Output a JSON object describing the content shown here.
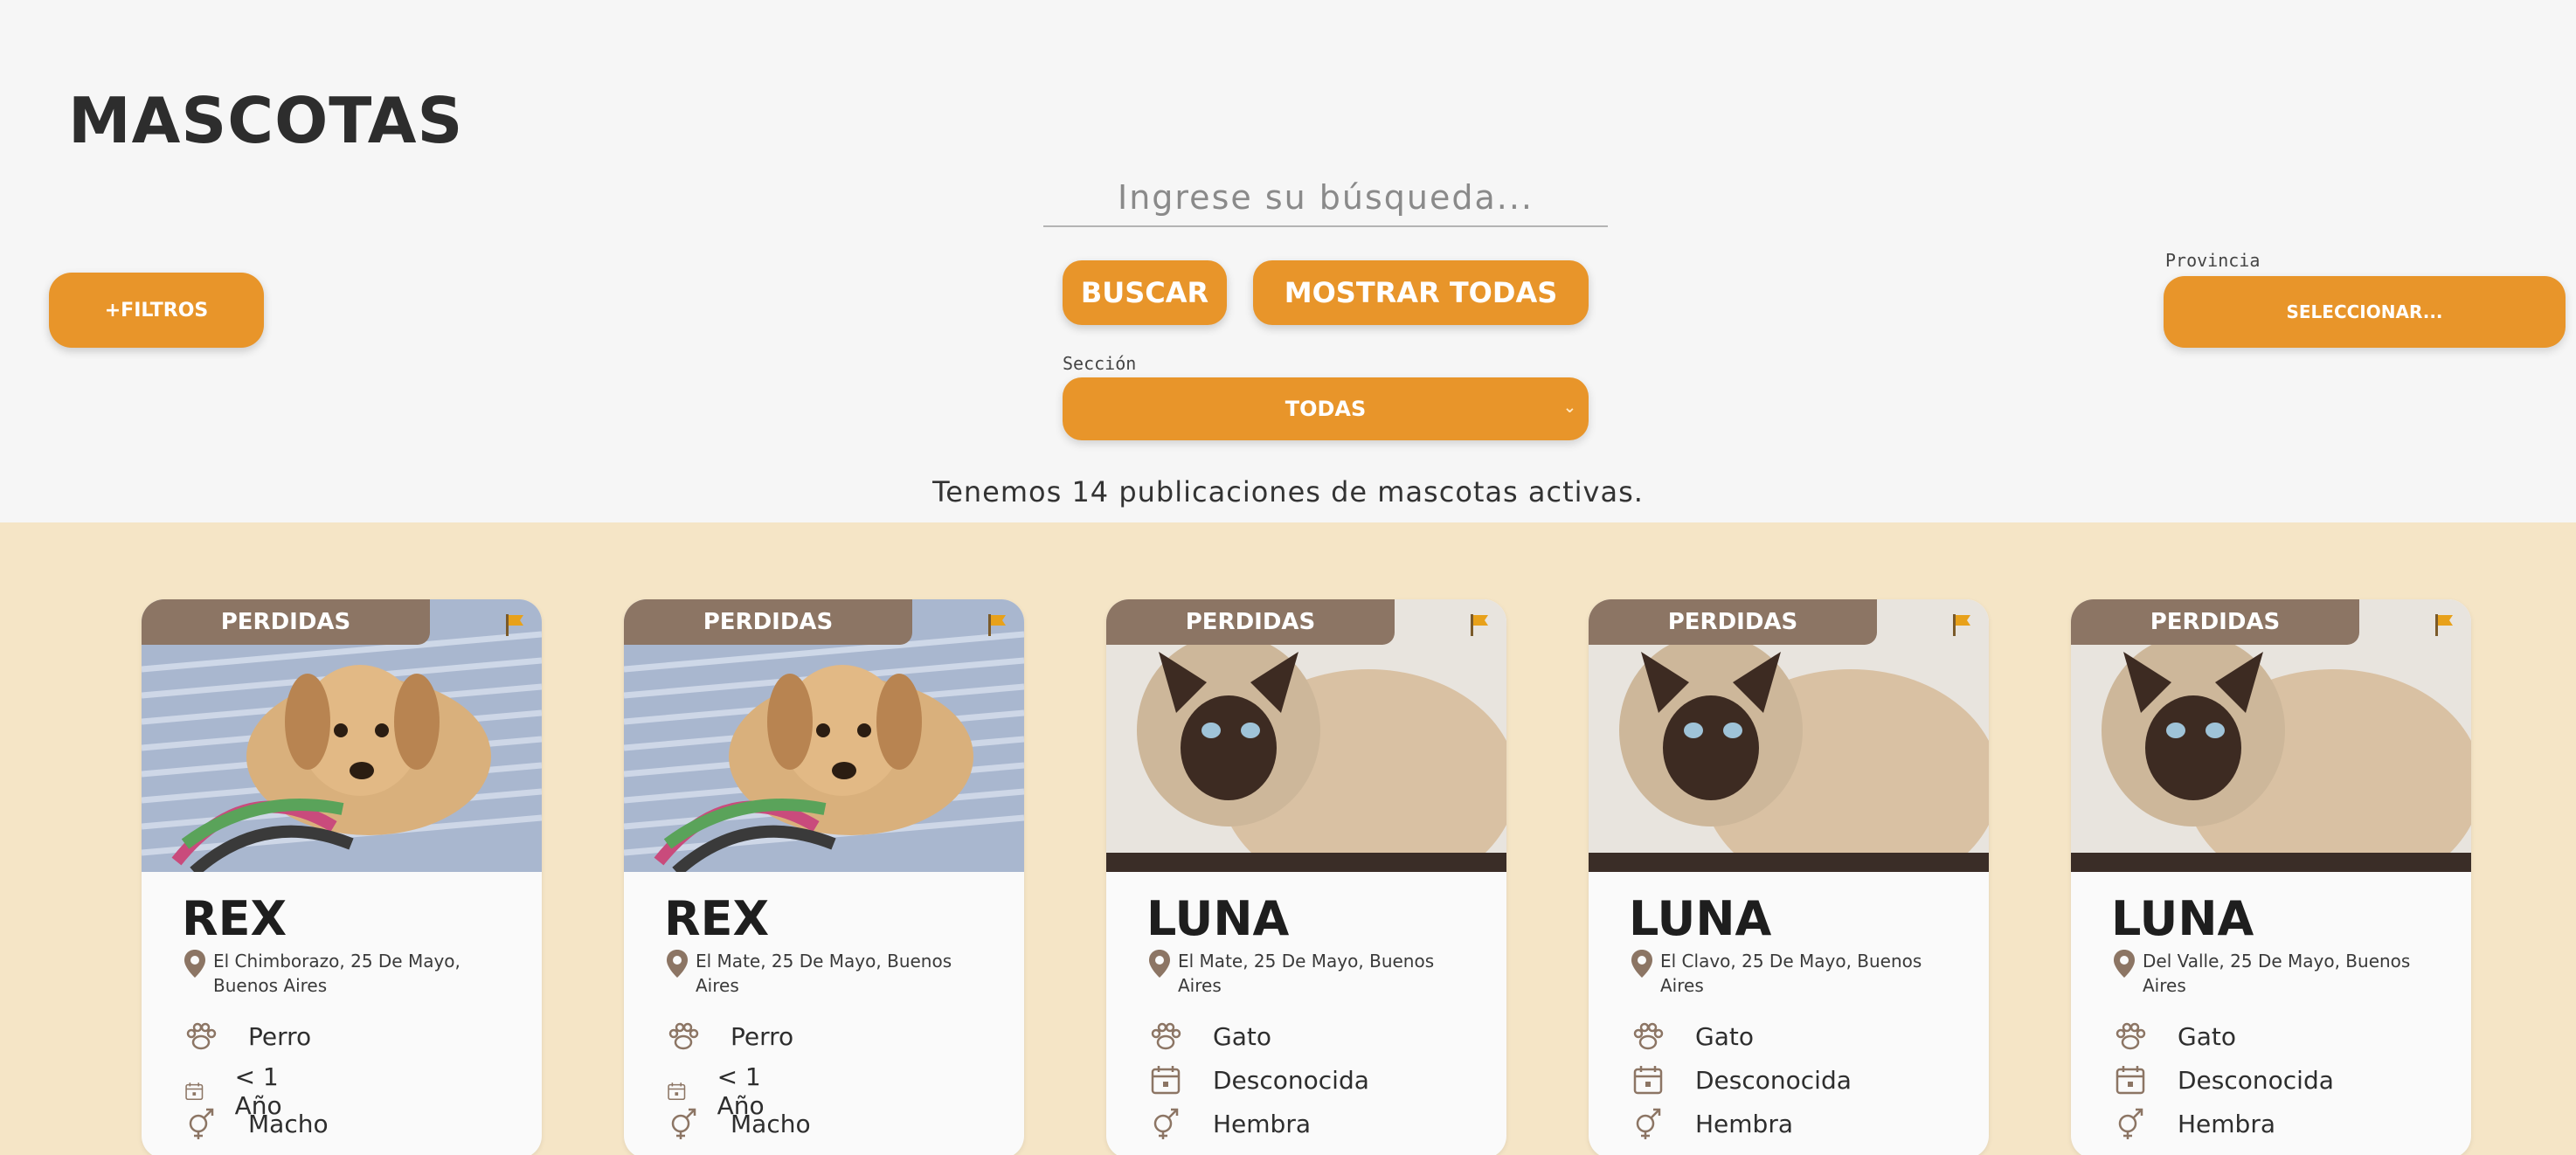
{
  "page": {
    "title": "MASCOTAS"
  },
  "filters": {
    "toggle_label": "+FILTROS",
    "search_placeholder": "Ingrese su búsqueda...",
    "search_button": "BUSCAR",
    "show_all_button": "MOSTRAR TODAS",
    "section_label": "Sección",
    "section_value": "TODAS",
    "province_label": "Provincia",
    "province_value": "SELECCIONAR..."
  },
  "summary": "Tenemos 14 publicaciones de mascotas activas.",
  "colors": {
    "accent": "#e8952a",
    "band": "#f5e5c6",
    "badge": "#8c7564"
  },
  "cards": [
    {
      "status": "PERDIDAS",
      "name": "REX",
      "location": "El Chimborazo, 25 De Mayo, Buenos Aires",
      "species": "Perro",
      "age": "< 1 Año",
      "sex": "Macho",
      "image": "puppy-photo"
    },
    {
      "status": "PERDIDAS",
      "name": "REX",
      "location": "El Mate, 25 De Mayo, Buenos Aires",
      "species": "Perro",
      "age": "< 1 Año",
      "sex": "Macho",
      "image": "puppy-photo"
    },
    {
      "status": "PERDIDAS",
      "name": "LUNA",
      "location": "El Mate, 25 De Mayo, Buenos Aires",
      "species": "Gato",
      "age": "Desconocida",
      "sex": "Hembra",
      "image": "siamese-cat-photo"
    },
    {
      "status": "PERDIDAS",
      "name": "LUNA",
      "location": "El Clavo, 25 De Mayo, Buenos Aires",
      "species": "Gato",
      "age": "Desconocida",
      "sex": "Hembra",
      "image": "siamese-cat-photo"
    },
    {
      "status": "PERDIDAS",
      "name": "LUNA",
      "location": "Del Valle, 25 De Mayo, Buenos Aires",
      "species": "Gato",
      "age": "Desconocida",
      "sex": "Hembra",
      "image": "siamese-cat-photo"
    }
  ]
}
